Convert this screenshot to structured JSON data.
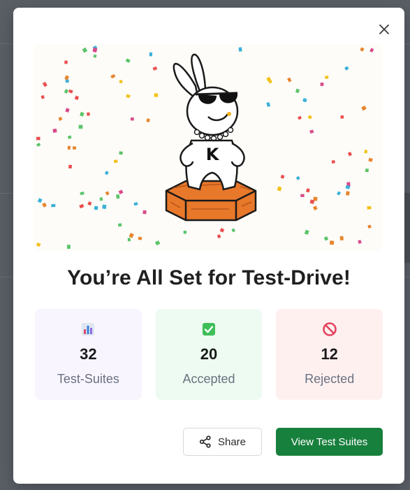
{
  "modal": {
    "title": "You’re All Set for Test-Drive!",
    "close_icon": "close-icon"
  },
  "illustration": {
    "mascot_letter": "K",
    "description_icon": "mascot-on-podium"
  },
  "stats": [
    {
      "icon": "bar-chart-icon",
      "value": "32",
      "label": "Test-Suites",
      "bg": "#f8f5ff"
    },
    {
      "icon": "check-box-icon",
      "value": "20",
      "label": "Accepted",
      "bg": "#edfbf2"
    },
    {
      "icon": "prohibited-icon",
      "value": "12",
      "label": "Rejected",
      "bg": "#fff0f0"
    }
  ],
  "actions": {
    "share_label": "Share",
    "share_icon": "share-icon",
    "primary_label": "View Test Suites",
    "primary_color": "#17803d"
  }
}
